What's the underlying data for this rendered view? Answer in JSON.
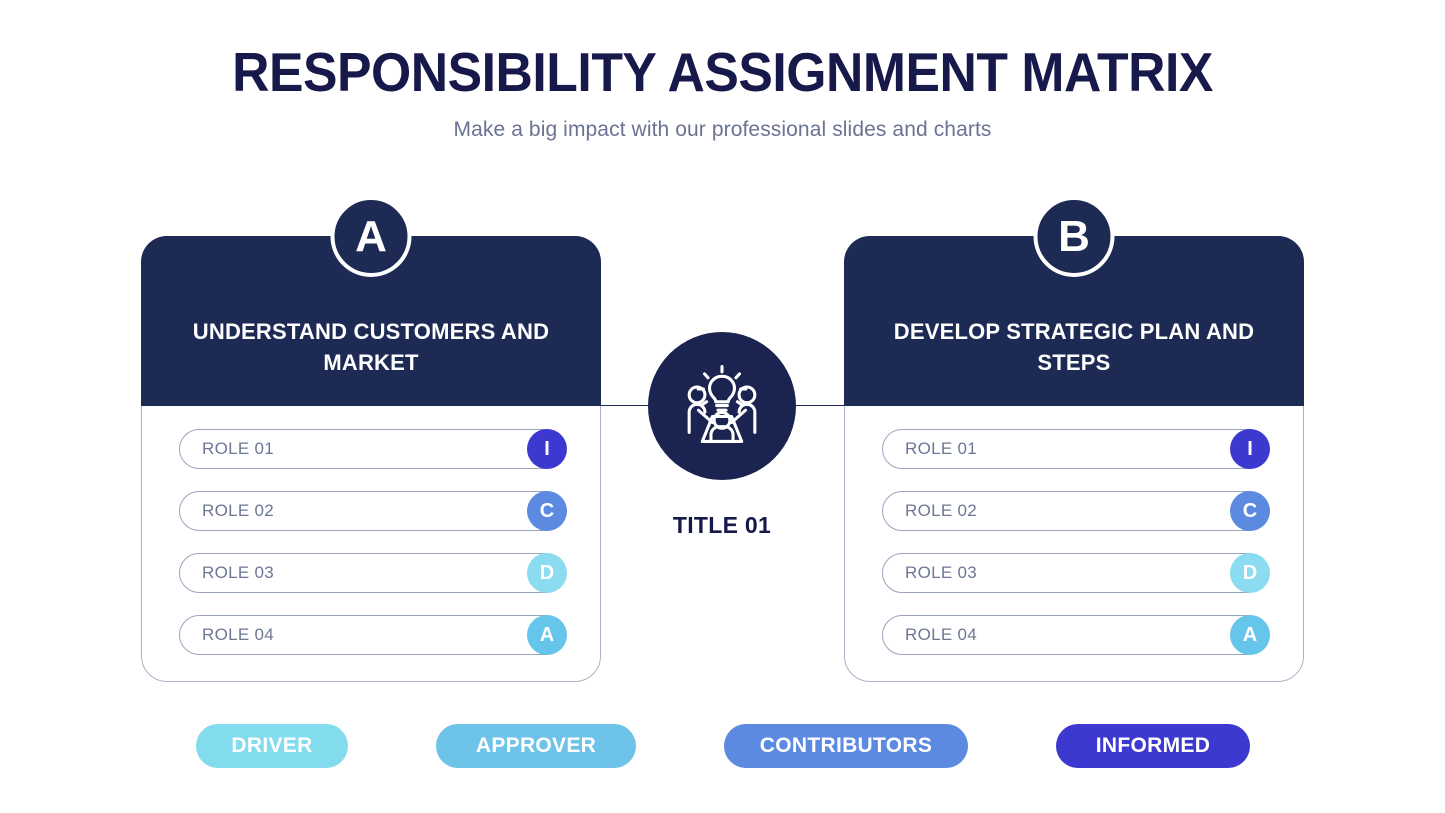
{
  "header": {
    "title": "RESPONSIBILITY ASSIGNMENT MATRIX",
    "subtitle": "Make a big impact with our professional slides and charts"
  },
  "center": {
    "title": "TITLE 01",
    "icon": "team-brainstorm-icon",
    "circle_color": "#1b2450"
  },
  "cards": [
    {
      "letter": "A",
      "title": "UNDERSTAND CUSTOMERS AND MARKET",
      "roles": [
        {
          "label": "ROLE 01",
          "badge": "I",
          "color": "#3d38cf"
        },
        {
          "label": "ROLE 02",
          "badge": "C",
          "color": "#5b8ae0"
        },
        {
          "label": "ROLE 03",
          "badge": "D",
          "color": "#8bdcf0"
        },
        {
          "label": "ROLE 04",
          "badge": "A",
          "color": "#65c5ea"
        }
      ]
    },
    {
      "letter": "B",
      "title": "DEVELOP STRATEGIC PLAN AND STEPS",
      "roles": [
        {
          "label": "ROLE 01",
          "badge": "I",
          "color": "#3d38cf"
        },
        {
          "label": "ROLE 02",
          "badge": "C",
          "color": "#5b8ae0"
        },
        {
          "label": "ROLE 03",
          "badge": "D",
          "color": "#8bdcf0"
        },
        {
          "label": "ROLE 04",
          "badge": "A",
          "color": "#65c5ea"
        }
      ]
    }
  ],
  "legend": [
    {
      "label": "DRIVER",
      "color": "#82dcee"
    },
    {
      "label": "APPROVER",
      "color": "#6ec3e8"
    },
    {
      "label": "CONTRIBUTORS",
      "color": "#5b8ae0"
    },
    {
      "label": "INFORMED",
      "color": "#3d38cf"
    }
  ],
  "theme": {
    "navy": "#1c2a54",
    "title_color": "#16194a",
    "subtitle_color": "#6b7293",
    "role_text_color": "#6e7695",
    "card_border_color": "#aab2c8",
    "background": "#ffffff"
  }
}
